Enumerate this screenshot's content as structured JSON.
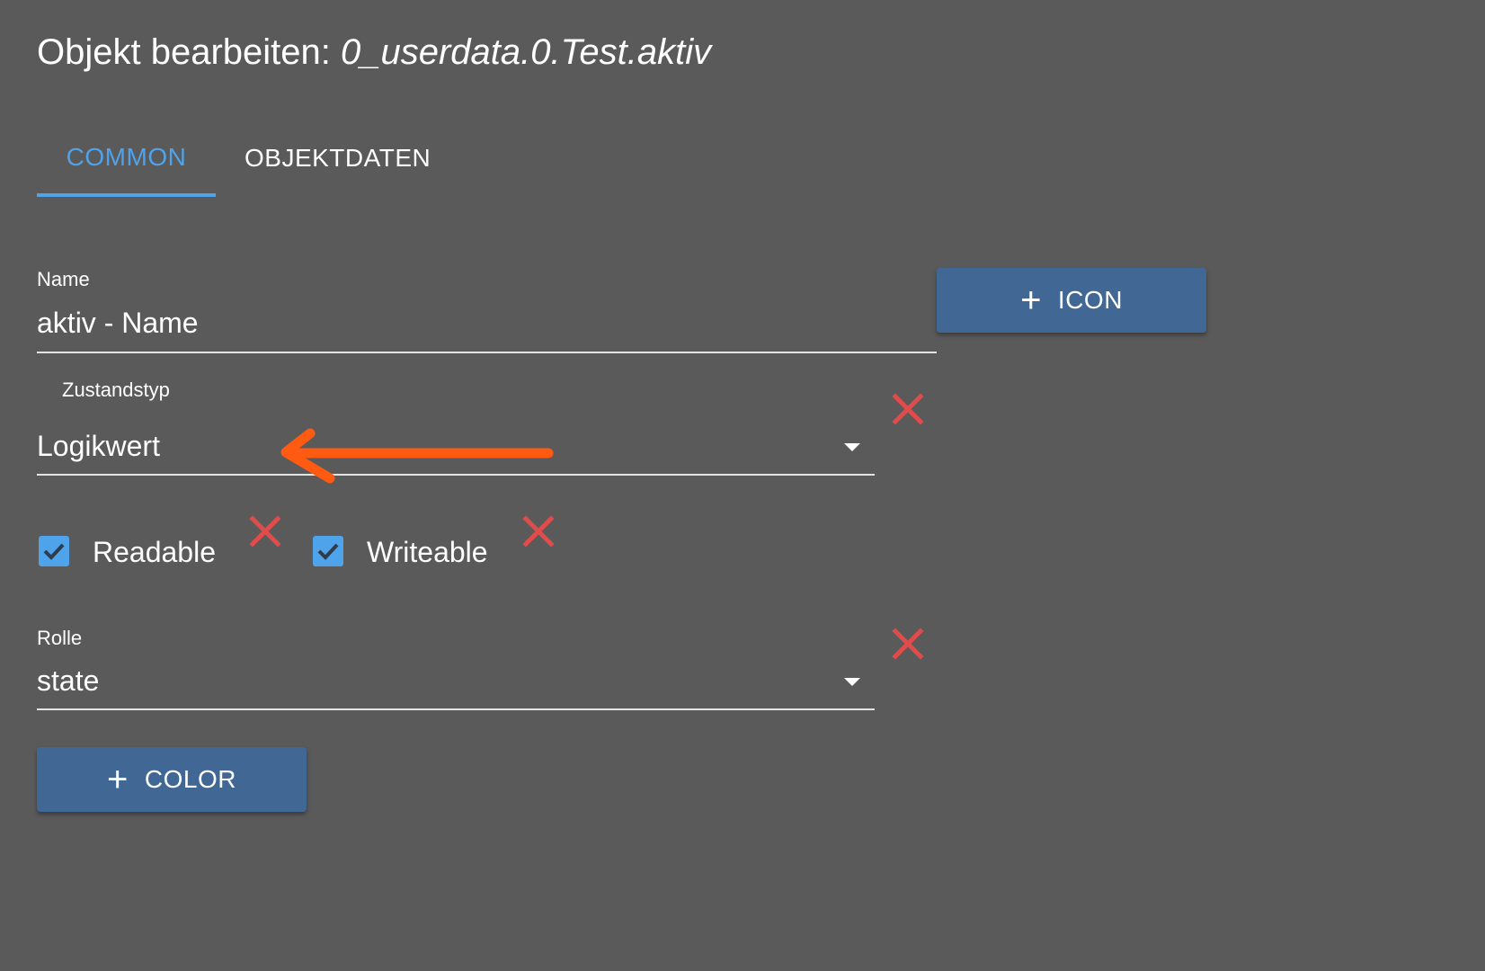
{
  "dialog": {
    "title_prefix": "Objekt bearbeiten: ",
    "object_id": "0_userdata.0.Test.aktiv"
  },
  "tabs": [
    {
      "label": "COMMON",
      "active": true
    },
    {
      "label": "OBJEKTDATEN",
      "active": false
    }
  ],
  "fields": {
    "name": {
      "label": "Name",
      "value": "aktiv - Name"
    },
    "state_type": {
      "label": "Zustandstyp",
      "value": "Logikwert"
    },
    "role": {
      "label": "Rolle",
      "value": "state"
    }
  },
  "checkboxes": {
    "readable": {
      "label": "Readable",
      "checked": true
    },
    "writeable": {
      "label": "Writeable",
      "checked": true
    }
  },
  "buttons": {
    "icon": {
      "plus": "+",
      "label": "ICON"
    },
    "color": {
      "plus": "+",
      "label": "COLOR"
    }
  },
  "icons": {
    "remove": "close-icon",
    "dropdown": "caret-down-icon",
    "check": "checkmark-icon",
    "annotation": "arrow-annotation-icon"
  },
  "colors": {
    "background": "#5a5a5a",
    "accent": "#4ea3ea",
    "button": "#416895",
    "remove": "#e04b4b",
    "annotation_arrow": "#ff5a12"
  }
}
